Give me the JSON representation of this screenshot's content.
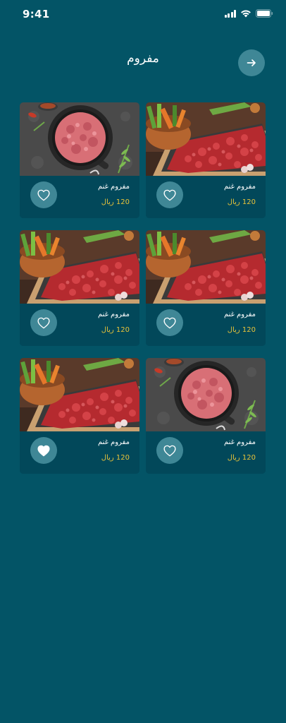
{
  "status_bar": {
    "time": "9:41"
  },
  "header": {
    "title": "مفروم"
  },
  "products": [
    {
      "name": "مفروم غنم",
      "price": "120 ريال",
      "image": "board-mince",
      "favorite": false
    },
    {
      "name": "مفروم غنم",
      "price": "120 ريال",
      "image": "pan-mince",
      "favorite": false
    },
    {
      "name": "مفروم غنم",
      "price": "120 ريال",
      "image": "board-mince",
      "favorite": false
    },
    {
      "name": "مفروم غنم",
      "price": "120 ريال",
      "image": "board-mince",
      "favorite": false
    },
    {
      "name": "مفروم غنم",
      "price": "120 ريال",
      "image": "pan-mince",
      "favorite": false
    },
    {
      "name": "مفروم غنم",
      "price": "120 ريال",
      "image": "board-mince",
      "favorite": true
    }
  ],
  "icons": {
    "back": "arrow-right-icon",
    "favorite": "heart-icon"
  },
  "colors": {
    "background": "#035466",
    "card": "#02485a",
    "circle_button": "#3f8796",
    "price": "#e8c33a"
  }
}
